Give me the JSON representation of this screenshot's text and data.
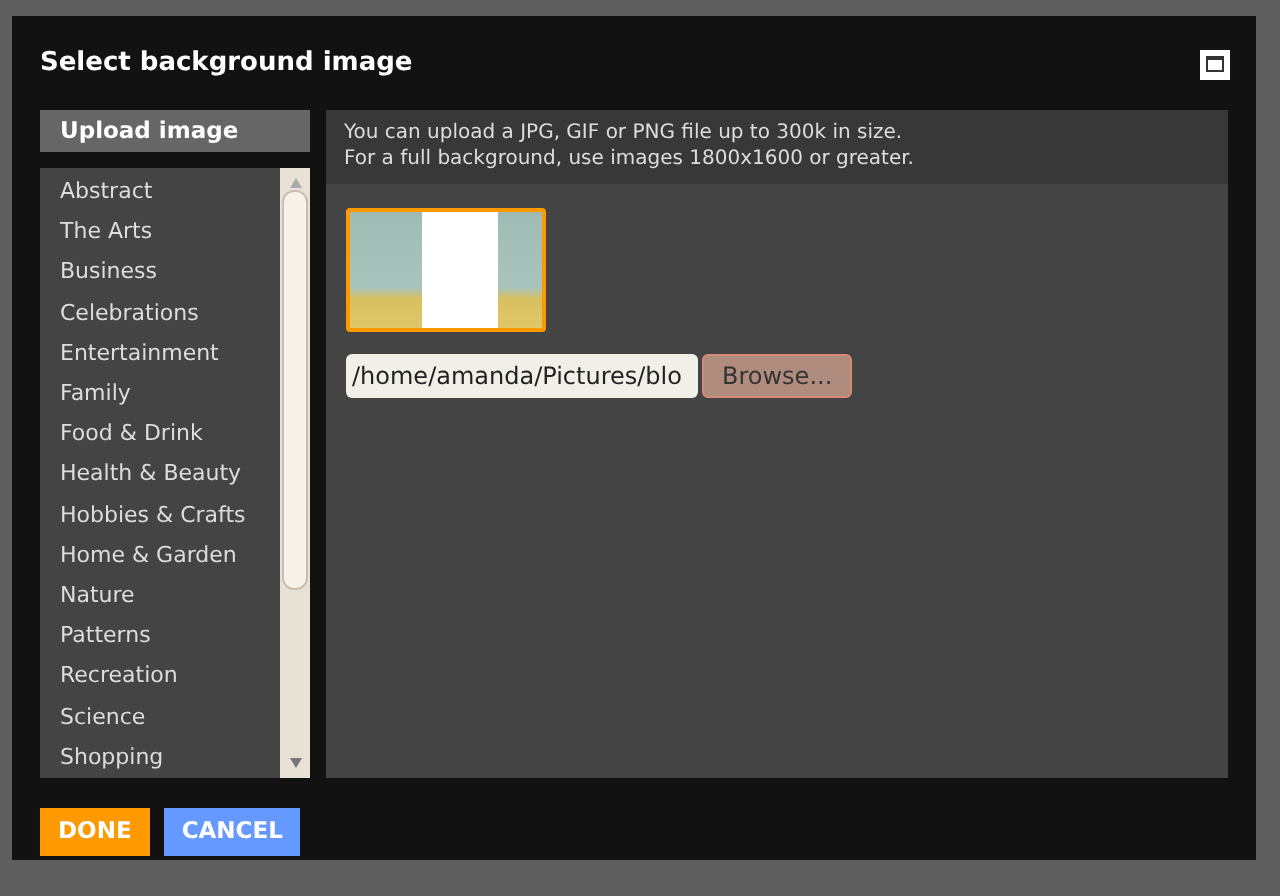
{
  "dialog": {
    "title": "Select background image"
  },
  "sidebar": {
    "upload_tab": {
      "label": "Upload image",
      "selected": true
    },
    "categories": [
      {
        "label": "Abstract",
        "selected": false
      },
      {
        "label": "The Arts",
        "selected": false
      },
      {
        "label": "Business",
        "selected": false
      },
      {
        "label": "Celebrations",
        "selected": false
      },
      {
        "label": "Entertainment",
        "selected": false
      },
      {
        "label": "Family",
        "selected": false
      },
      {
        "label": "Food & Drink",
        "selected": false
      },
      {
        "label": "Health & Beauty",
        "selected": false
      },
      {
        "label": "Hobbies & Crafts",
        "selected": false
      },
      {
        "label": "Home & Garden",
        "selected": false
      },
      {
        "label": "Nature",
        "selected": false
      },
      {
        "label": "Patterns",
        "selected": false
      },
      {
        "label": "Recreation",
        "selected": false
      },
      {
        "label": "Science",
        "selected": false
      },
      {
        "label": "Shopping",
        "selected": false
      }
    ]
  },
  "upload": {
    "info_lines": [
      "You can upload a JPG, GIF or PNG file up to 300k in size.",
      "For a full background, use images 1800x1600 or greater."
    ],
    "file_value": "/home/amanda/Pictures/blo",
    "browse_label": "Browse..."
  },
  "buttons": [
    {
      "label": "DONE",
      "kind": "primary"
    },
    {
      "label": "CANCEL",
      "kind": "secondary"
    }
  ]
}
